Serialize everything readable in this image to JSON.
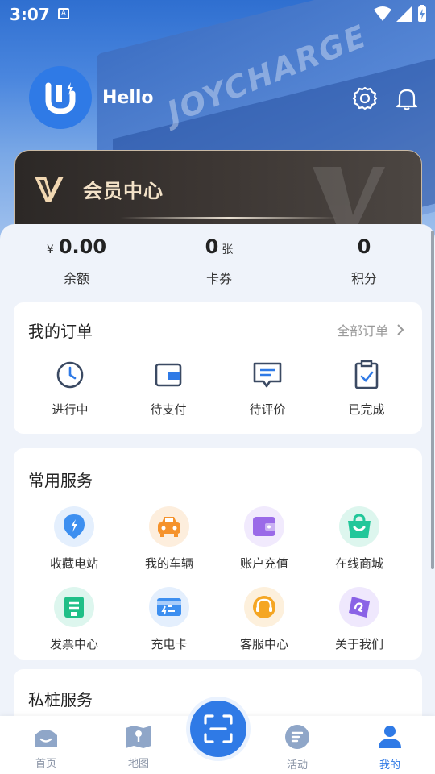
{
  "status_bar": {
    "time": "3:07",
    "notification_badge": "A"
  },
  "hero": {
    "building_sign": "JOYCHARGE"
  },
  "profile": {
    "greeting": "Hello"
  },
  "member_card": {
    "title": "会员中心"
  },
  "stats": [
    {
      "currency": "¥",
      "value": "0.00",
      "unit": "",
      "label": "余额"
    },
    {
      "currency": "",
      "value": "0",
      "unit": "张",
      "label": "卡券"
    },
    {
      "currency": "",
      "value": "0",
      "unit": "",
      "label": "积分"
    }
  ],
  "orders": {
    "title": "我的订单",
    "all_label": "全部订单",
    "items": [
      {
        "label": "进行中",
        "icon": "clock-icon"
      },
      {
        "label": "待支付",
        "icon": "wallet-icon"
      },
      {
        "label": "待评价",
        "icon": "comment-icon"
      },
      {
        "label": "已完成",
        "icon": "clipboard-check-icon"
      }
    ]
  },
  "services": {
    "title": "常用服务",
    "items": [
      {
        "label": "收藏电站",
        "icon": "location-bolt-icon",
        "color": "#3d8ff0"
      },
      {
        "label": "我的车辆",
        "icon": "car-icon",
        "color": "#f5922b"
      },
      {
        "label": "账户充值",
        "icon": "wallet-icon",
        "color": "#9a6ae8"
      },
      {
        "label": "在线商城",
        "icon": "shopping-bag-icon",
        "color": "#22c79a"
      },
      {
        "label": "发票中心",
        "icon": "invoice-icon",
        "color": "#1fbf87"
      },
      {
        "label": "充电卡",
        "icon": "charge-card-icon",
        "color": "#3d8ff0"
      },
      {
        "label": "客服中心",
        "icon": "headset-icon",
        "color": "#f5a623"
      },
      {
        "label": "关于我们",
        "icon": "about-icon",
        "color": "#8a63e6"
      }
    ]
  },
  "private_services": {
    "title": "私桩服务"
  },
  "bottom_nav": {
    "items": [
      {
        "label": "首页",
        "icon": "home-icon"
      },
      {
        "label": "地图",
        "icon": "map-icon"
      },
      {
        "label": "活动",
        "icon": "activity-icon"
      },
      {
        "label": "我的",
        "icon": "profile-icon",
        "active": true
      }
    ],
    "center_icon": "scan-icon"
  },
  "colors": {
    "primary": "#2f7ae6",
    "member_gold": "#f3e2c8"
  }
}
